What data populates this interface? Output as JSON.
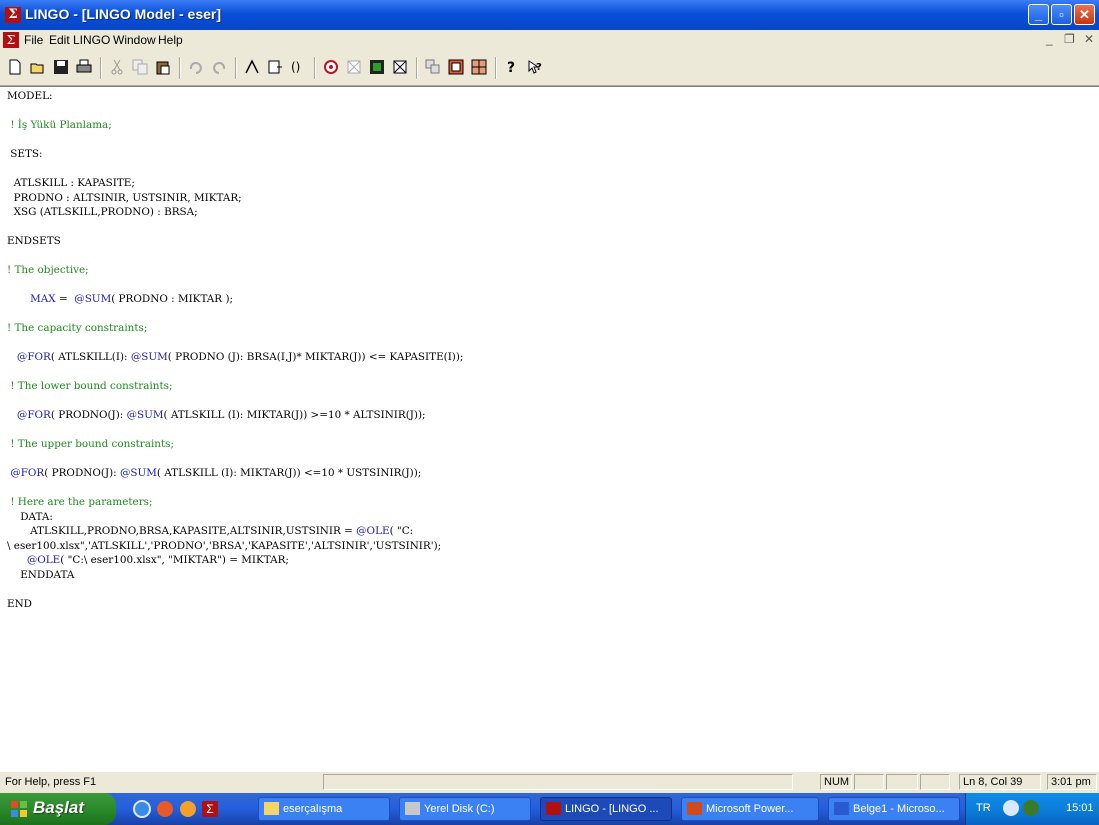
{
  "window": {
    "title": "LINGO - [LINGO Model - eser]"
  },
  "menu": [
    "File",
    "Edit",
    "LINGO",
    "Window",
    "Help"
  ],
  "toolbar_buttons": [
    "new",
    "open",
    "save",
    "print",
    "cut",
    "copy",
    "paste",
    "undo",
    "redo",
    "find",
    "goto",
    "match-paren",
    "solve",
    "solution",
    "matrix-picture",
    "send-to-back",
    "close-all",
    "tile",
    "options",
    "help",
    "context-help"
  ],
  "editor": {
    "lines": [
      [
        {
          "t": "MODEL:"
        }
      ],
      [],
      [
        {
          "t": " "
        },
        {
          "t": "! İş Yükü Planlama;",
          "c": "cm"
        }
      ],
      [],
      [
        {
          "t": " SETS:"
        }
      ],
      [],
      [
        {
          "t": "  ATLSKILL : KAPASITE;"
        }
      ],
      [
        {
          "t": "  PRODNO : ALTSINIR, USTSINIR, MIKTAR;"
        }
      ],
      [
        {
          "t": "  XSG (ATLSKILL,PRODNO) : BRSA;"
        }
      ],
      [],
      [
        {
          "t": "ENDSETS"
        }
      ],
      [],
      [
        {
          "t": "! The objective;",
          "c": "cm"
        }
      ],
      [],
      [
        {
          "t": "       "
        },
        {
          "t": "MAX",
          "c": "kw"
        },
        {
          "t": " =  "
        },
        {
          "t": "@SUM",
          "c": "kw"
        },
        {
          "t": "( PRODNO : MIKTAR );"
        }
      ],
      [],
      [
        {
          "t": "! The capacity constraints;",
          "c": "cm"
        }
      ],
      [],
      [
        {
          "t": "   "
        },
        {
          "t": "@FOR",
          "c": "kw"
        },
        {
          "t": "( ATLSKILL(I): "
        },
        {
          "t": "@SUM",
          "c": "kw"
        },
        {
          "t": "( PRODNO (J): BRSA(I,J)* MIKTAR(J)) <= KAPASITE(I));"
        }
      ],
      [],
      [
        {
          "t": " "
        },
        {
          "t": "! The lower bound constraints;",
          "c": "cm"
        }
      ],
      [],
      [
        {
          "t": "   "
        },
        {
          "t": "@FOR",
          "c": "kw"
        },
        {
          "t": "( PRODNO(J): "
        },
        {
          "t": "@SUM",
          "c": "kw"
        },
        {
          "t": "( ATLSKILL (I): MIKTAR(J)) >=10 * ALTSINIR(J));"
        }
      ],
      [],
      [
        {
          "t": " "
        },
        {
          "t": "! The upper bound constraints;",
          "c": "cm"
        }
      ],
      [],
      [
        {
          "t": " "
        },
        {
          "t": "@FOR",
          "c": "kw"
        },
        {
          "t": "( PRODNO(J): "
        },
        {
          "t": "@SUM",
          "c": "kw"
        },
        {
          "t": "( ATLSKILL (I): MIKTAR(J)) <=10 * USTSINIR(J));"
        }
      ],
      [],
      [
        {
          "t": " "
        },
        {
          "t": "! Here are the parameters;",
          "c": "cm"
        }
      ],
      [
        {
          "t": "    DATA:"
        }
      ],
      [
        {
          "t": "       ATLSKILL,PRODNO,BRSA,KAPASITE,ALTSINIR,USTSINIR = "
        },
        {
          "t": "@OLE",
          "c": "kw"
        },
        {
          "t": "( \"C:"
        }
      ],
      [
        {
          "t": "\\ eser100.xlsx\",'ATLSKILL','PRODNO','BRSA','KAPASITE','ALTSINIR','USTSINIR');"
        }
      ],
      [
        {
          "t": "      "
        },
        {
          "t": "@OLE",
          "c": "kw"
        },
        {
          "t": "( \"C:\\ eser100.xlsx\", \"MIKTAR\") = MIKTAR;"
        }
      ],
      [
        {
          "t": "    ENDDATA"
        }
      ],
      [],
      [
        {
          "t": "END"
        }
      ]
    ]
  },
  "status": {
    "help": "For Help, press F1",
    "num": "NUM",
    "position": "Ln 8, Col 39",
    "time": "3:01 pm"
  },
  "taskbar": {
    "start": "Başlat",
    "tasks": [
      {
        "label": "eserçalışma",
        "icon": "folder-icon"
      },
      {
        "label": "Yerel Disk (C:)",
        "icon": "drive-icon"
      },
      {
        "label": "LINGO - [LINGO ...",
        "icon": "lingo-icon",
        "active": true
      },
      {
        "label": "Microsoft Power...",
        "icon": "powerpoint-icon"
      },
      {
        "label": "Belge1 - Microso...",
        "icon": "word-icon"
      }
    ],
    "lang": "TR",
    "clock": "15:01"
  }
}
